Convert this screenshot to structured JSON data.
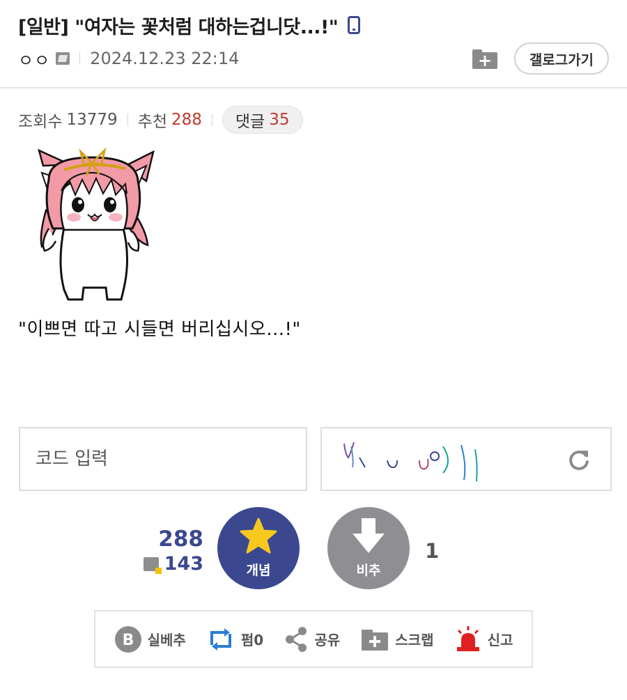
{
  "post": {
    "title": "[일반] \"여자는 꽃처럼 대하는겁니닷...!\"",
    "author": "ㅇㅇ",
    "date": "2024.12.23 22:14",
    "gallery_button": "갤로그가기",
    "body_text": "\"이쁘면 따고 시들면 버리십시오...!\""
  },
  "stats": {
    "views_label": "조회수",
    "views": "13779",
    "recommend_label": "추천",
    "recommend": "288",
    "comments_label": "댓글",
    "comments": "35"
  },
  "captcha": {
    "placeholder": "코드 입력"
  },
  "votes": {
    "up_count": "288",
    "fixed_up_count": "143",
    "up_label": "개념",
    "down_label": "비추",
    "down_count": "1"
  },
  "actions": {
    "best": "실베추",
    "repost": "펌0",
    "share": "공유",
    "scrap": "스크랩",
    "report": "신고"
  },
  "colors": {
    "accent": "#3b4890",
    "red": "#c0392b",
    "downvote": "#8e8e93",
    "report": "#e02020",
    "repost": "#2a7fd4"
  }
}
